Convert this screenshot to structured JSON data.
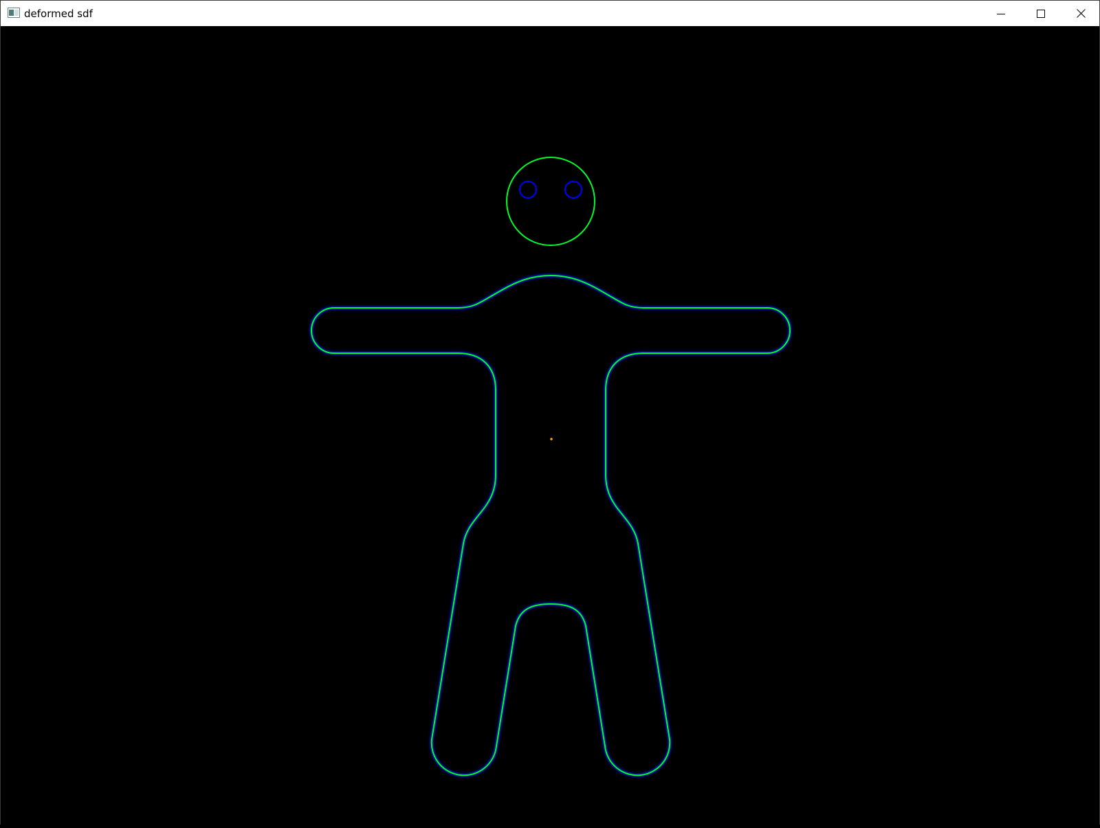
{
  "window": {
    "title": "deformed sdf",
    "buttons": {
      "minimize": "minimize",
      "maximize": "maximize",
      "close": "close"
    }
  },
  "scene": {
    "background_color": "#000000",
    "outline_color": "#00ff2a",
    "eye_color": "#0000ff",
    "center_marker_color": "#ffa500"
  }
}
